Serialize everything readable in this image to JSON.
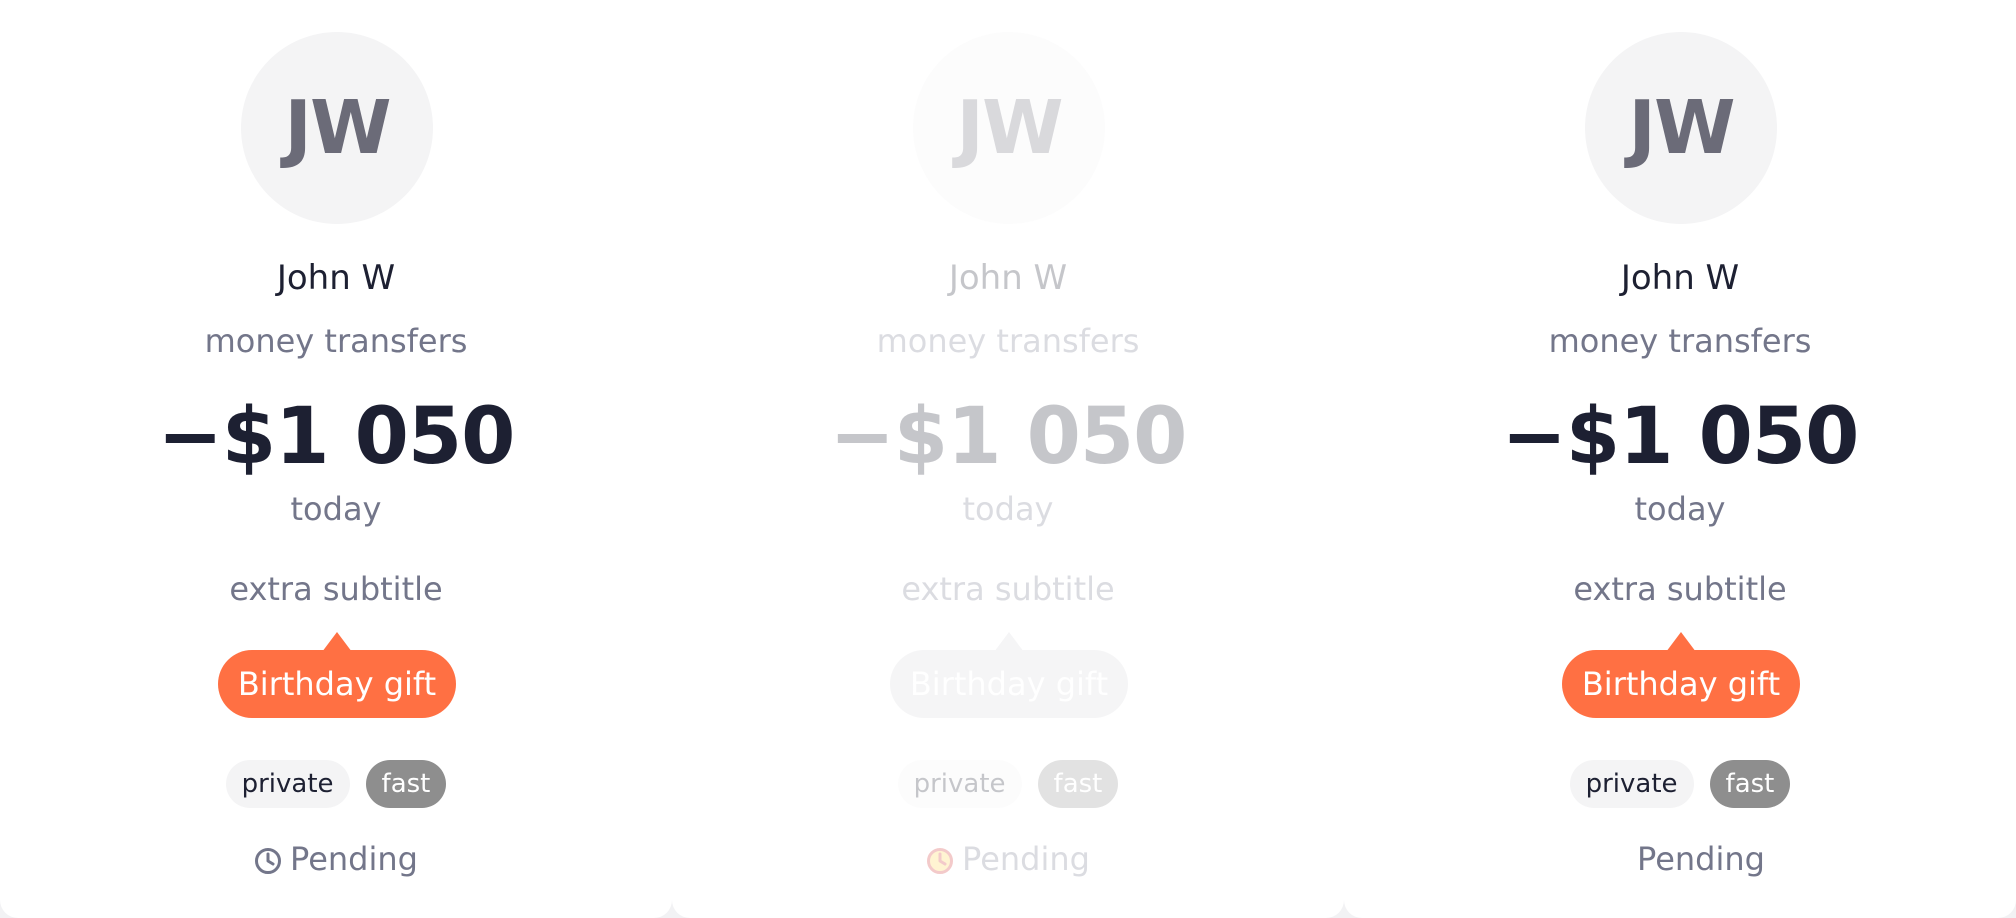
{
  "cards": [
    {
      "avatar_initials": "JW",
      "name": "John W",
      "category": "money transfers",
      "amount": "−$1 050",
      "date": "today",
      "extra_subtitle": "extra subtitle",
      "tag": "Birthday gift",
      "chips": [
        "private",
        "fast"
      ],
      "status": "Pending",
      "status_icon": "clock-icon"
    },
    {
      "avatar_initials": "JW",
      "name": "John W",
      "category": "money transfers",
      "amount": "−$1 050",
      "date": "today",
      "extra_subtitle": "extra subtitle",
      "tag": "Birthday gift",
      "chips": [
        "private",
        "fast"
      ],
      "status": "Pending",
      "status_icon": "clock-icon"
    },
    {
      "avatar_initials": "JW",
      "name": "John W",
      "category": "money transfers",
      "amount": "−$1 050",
      "date": "today",
      "extra_subtitle": "extra subtitle",
      "tag": "Birthday gift",
      "chips": [
        "private",
        "fast"
      ],
      "status": "Pending"
    }
  ],
  "colors": {
    "accent": "#ff7043",
    "text_primary": "#1d2032",
    "text_secondary": "#73768a",
    "avatar_bg": "#f4f4f5",
    "chip_fast_bg": "#8e8e8e",
    "status_icon_disabled": "#d32f2f"
  }
}
